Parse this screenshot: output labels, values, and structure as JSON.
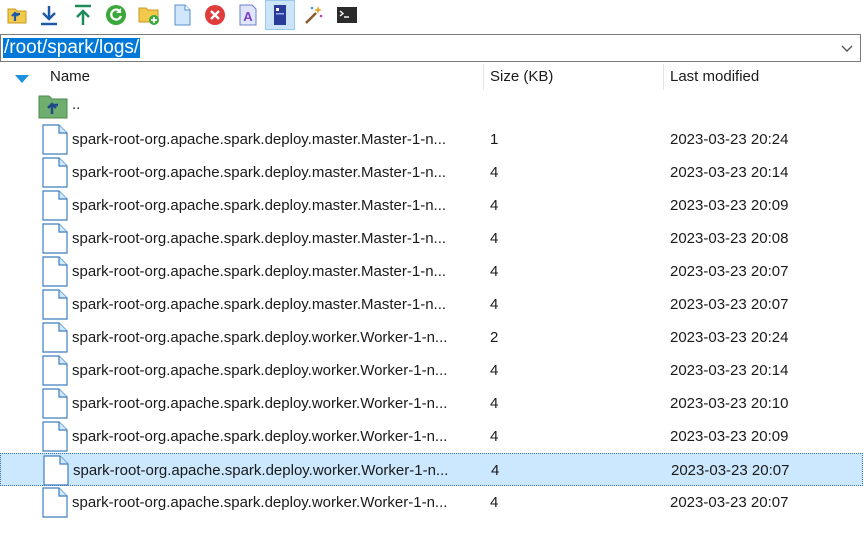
{
  "toolbar": {
    "buttons": [
      {
        "name": "parent-folder-icon"
      },
      {
        "name": "download-icon"
      },
      {
        "name": "upload-icon"
      },
      {
        "name": "refresh-icon"
      },
      {
        "name": "new-folder-icon"
      },
      {
        "name": "new-file-icon"
      },
      {
        "name": "delete-icon"
      },
      {
        "name": "rename-icon"
      },
      {
        "name": "properties-icon",
        "active": true
      },
      {
        "name": "magic-wand-icon"
      },
      {
        "name": "terminal-icon"
      }
    ]
  },
  "path": {
    "value": "/root/spark/logs/"
  },
  "columns": {
    "name": "Name",
    "size": "Size (KB)",
    "modified": "Last modified"
  },
  "parent_row": {
    "label": ".."
  },
  "files": [
    {
      "name": "spark-root-org.apache.spark.deploy.master.Master-1-n...",
      "size": "1",
      "modified": "2023-03-23 20:24"
    },
    {
      "name": "spark-root-org.apache.spark.deploy.master.Master-1-n...",
      "size": "4",
      "modified": "2023-03-23 20:14"
    },
    {
      "name": "spark-root-org.apache.spark.deploy.master.Master-1-n...",
      "size": "4",
      "modified": "2023-03-23 20:09"
    },
    {
      "name": "spark-root-org.apache.spark.deploy.master.Master-1-n...",
      "size": "4",
      "modified": "2023-03-23 20:08"
    },
    {
      "name": "spark-root-org.apache.spark.deploy.master.Master-1-n...",
      "size": "4",
      "modified": "2023-03-23 20:07"
    },
    {
      "name": "spark-root-org.apache.spark.deploy.master.Master-1-n...",
      "size": "4",
      "modified": "2023-03-23 20:07"
    },
    {
      "name": "spark-root-org.apache.spark.deploy.worker.Worker-1-n...",
      "size": "2",
      "modified": "2023-03-23 20:24"
    },
    {
      "name": "spark-root-org.apache.spark.deploy.worker.Worker-1-n...",
      "size": "4",
      "modified": "2023-03-23 20:14"
    },
    {
      "name": "spark-root-org.apache.spark.deploy.worker.Worker-1-n...",
      "size": "4",
      "modified": "2023-03-23 20:10"
    },
    {
      "name": "spark-root-org.apache.spark.deploy.worker.Worker-1-n...",
      "size": "4",
      "modified": "2023-03-23 20:09"
    },
    {
      "name": "spark-root-org.apache.spark.deploy.worker.Worker-1-n...",
      "size": "4",
      "modified": "2023-03-23 20:07",
      "selected": true
    },
    {
      "name": "spark-root-org.apache.spark.deploy.worker.Worker-1-n...",
      "size": "4",
      "modified": "2023-03-23 20:07"
    }
  ],
  "colors": {
    "selection": "#cce8ff",
    "path_highlight": "#0078d7",
    "accent": "#1e73c8"
  }
}
